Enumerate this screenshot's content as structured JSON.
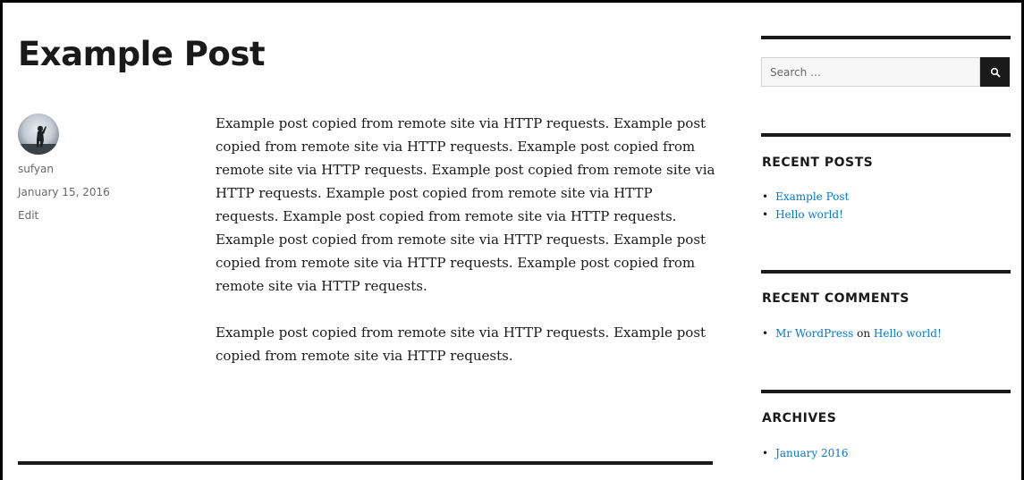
{
  "post": {
    "title": "Example Post",
    "author": "sufyan",
    "date": "January 15, 2016",
    "edit_label": "Edit",
    "paragraphs": [
      "Example post copied from remote site via HTTP requests. Example post copied from remote site via HTTP requests. Example post copied from remote site via HTTP requests. Example post copied from remote site via HTTP requests. Example post copied from remote site via HTTP requests. Example post copied from remote site via HTTP requests. Example post copied from remote site via HTTP requests. Example post copied from remote site via HTTP requests. Example post copied from remote site via HTTP requests.",
      "Example post copied from remote site via HTTP requests. Example post copied from remote site via HTTP requests."
    ]
  },
  "sidebar": {
    "search": {
      "placeholder": "Search …",
      "button_icon": "search-icon"
    },
    "recent_posts": {
      "title": "RECENT POSTS",
      "items": [
        "Example Post",
        "Hello world!"
      ]
    },
    "recent_comments": {
      "title": "RECENT COMMENTS",
      "items": [
        {
          "author": "Mr WordPress",
          "connector": "on",
          "post": "Hello world!"
        }
      ]
    },
    "archives": {
      "title": "ARCHIVES",
      "items": [
        "January 2016"
      ]
    }
  },
  "colors": {
    "link": "#007acc",
    "text": "#1a1a1a",
    "meta": "#686868"
  }
}
